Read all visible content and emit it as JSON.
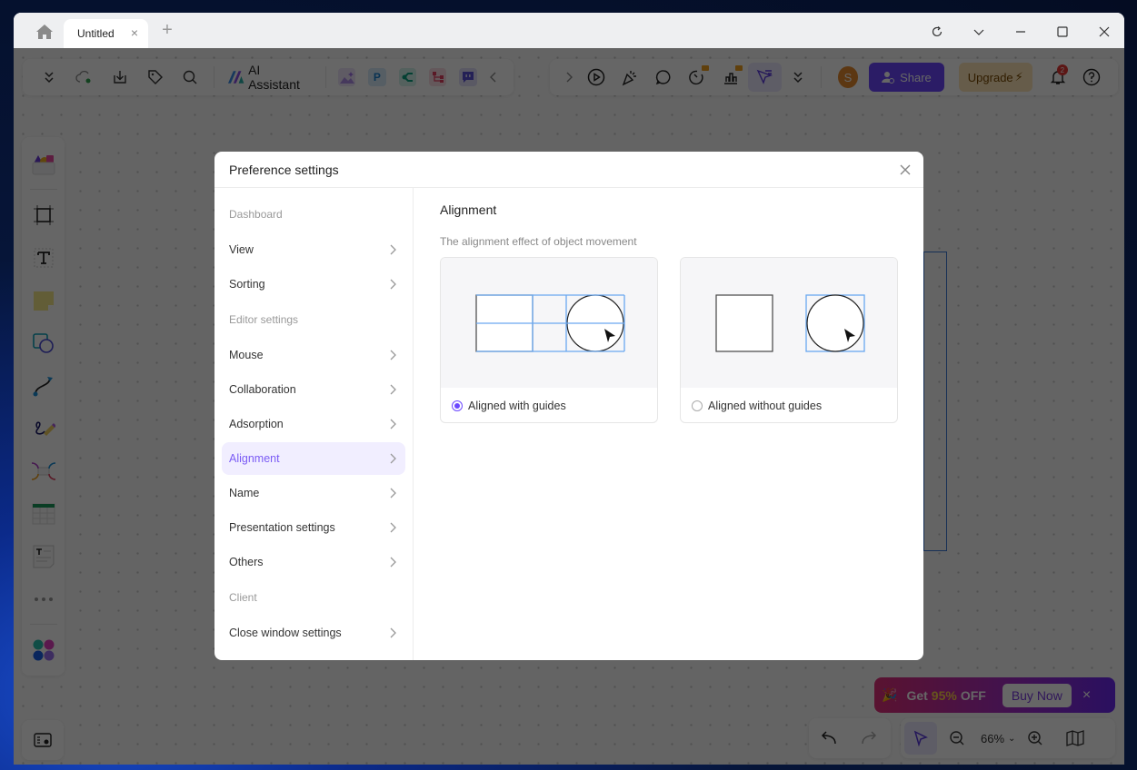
{
  "window": {
    "tab_title": "Untitled",
    "new_tab": "+",
    "controls": [
      "refresh",
      "dropdown",
      "minimize",
      "maximize",
      "close"
    ]
  },
  "toolbar_left": {
    "ai_assistant_label": "AI Assistant",
    "icons": [
      "collapse-icon",
      "cloud-sync-icon",
      "download-icon",
      "tag-icon",
      "search-icon"
    ],
    "apps": [
      {
        "name": "image-gen-app",
        "glyph": "",
        "color": "#a070e8",
        "bg": "#ede3fb"
      },
      {
        "name": "p-app",
        "glyph": "P",
        "color": "#1a7fd0",
        "bg": "#d6ecfb"
      },
      {
        "name": "mindmap-app",
        "glyph": "<",
        "color": "#0aa080",
        "bg": "#d2f2ea"
      },
      {
        "name": "flow-app",
        "glyph": "⋔",
        "color": "#e04060",
        "bg": "#fbdde3"
      },
      {
        "name": "chat-app",
        "glyph": "▣",
        "color": "#5a50d8",
        "bg": "#e1defb"
      }
    ]
  },
  "toolbar_right": {
    "avatar_initial": "S",
    "share_label": "Share",
    "upgrade_label": "Upgrade",
    "notification_count": "2"
  },
  "promo": {
    "prefix": "Get",
    "percent": "95%",
    "suffix": "OFF",
    "buy_label": "Buy Now",
    "close": "×"
  },
  "bottom": {
    "zoom_level": "66%"
  },
  "dialog": {
    "title": "Preference settings",
    "sidebar": [
      {
        "type": "group",
        "label": "Dashboard"
      },
      {
        "type": "item",
        "label": "View"
      },
      {
        "type": "item",
        "label": "Sorting"
      },
      {
        "type": "group",
        "label": "Editor settings"
      },
      {
        "type": "item",
        "label": "Mouse"
      },
      {
        "type": "item",
        "label": "Collaboration"
      },
      {
        "type": "item",
        "label": "Adsorption"
      },
      {
        "type": "item",
        "label": "Alignment",
        "active": true
      },
      {
        "type": "item",
        "label": "Name"
      },
      {
        "type": "item",
        "label": "Presentation settings"
      },
      {
        "type": "item",
        "label": "Others"
      },
      {
        "type": "group",
        "label": "Client"
      },
      {
        "type": "item",
        "label": "Close window settings"
      }
    ],
    "section_title": "Alignment",
    "section_desc": "The alignment effect of object movement",
    "options": [
      {
        "label": "Aligned with guides",
        "selected": true
      },
      {
        "label": "Aligned without guides",
        "selected": false
      }
    ],
    "accent_color": "#7b5cf5",
    "guide_color": "#6aa8f0"
  }
}
